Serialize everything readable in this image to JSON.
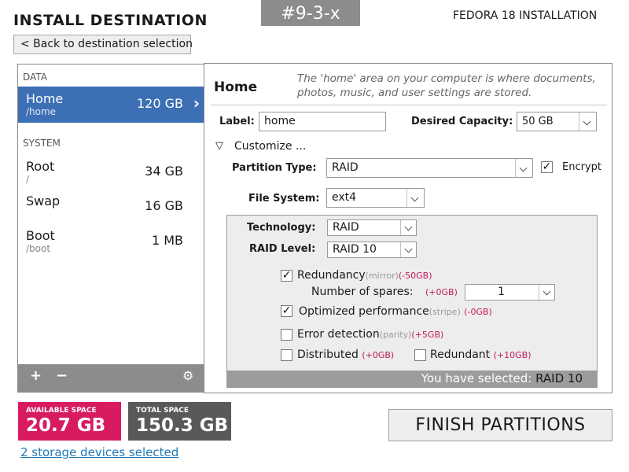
{
  "header": {
    "title": "INSTALL DESTINATION",
    "mockup_tag": "#9-3-x",
    "product": "FEDORA 18 INSTALLATION",
    "back_label": "< Back to destination selection"
  },
  "left_pane": {
    "data_header": "DATA",
    "system_header": "SYSTEM",
    "data_items": [
      {
        "name": "Home",
        "path": "/home",
        "size": "120 GB",
        "selected": true
      }
    ],
    "system_items": [
      {
        "name": "Root",
        "path": "/",
        "size": "34 GB"
      },
      {
        "name": "Swap",
        "path": "",
        "size": "16 GB"
      },
      {
        "name": "Boot",
        "path": "/boot",
        "size": "1 MB"
      }
    ],
    "toolbar": {
      "add": "+",
      "remove": "−",
      "settings": "⚙"
    }
  },
  "details": {
    "title": "Home",
    "description": "The 'home' area on your computer is where documents, photos, music, and user settings are stored.",
    "label_label": "Label:",
    "label_value": "home",
    "capacity_label": "Desired Capacity:",
    "capacity_value": "50 GB",
    "customize_label": "Customize ...",
    "partition_type_label": "Partition Type:",
    "partition_type_value": "RAID",
    "encrypt_label": "Encrypt",
    "encrypt_checked": true,
    "filesystem_label": "File System:",
    "filesystem_value": "ext4"
  },
  "raid": {
    "technology_label": "Technology:",
    "technology_value": "RAID",
    "level_label": "RAID Level:",
    "level_value": "RAID 10",
    "redundancy": {
      "label": "Redundancy",
      "hint": "(mirror)",
      "delta": "(-50GB)",
      "checked": true
    },
    "spares": {
      "label": "Number of spares:",
      "delta": "(+0GB)",
      "value": "1"
    },
    "optimized": {
      "label": "Optimized performance",
      "hint": "(stripe)",
      "delta": "(-0GB)",
      "checked": true
    },
    "error_detection": {
      "label": "Error detection",
      "hint": "(parity)",
      "delta": "(+5GB)",
      "checked": false
    },
    "distributed": {
      "label": "Distributed",
      "delta": "(+0GB)",
      "checked": false
    },
    "redundant": {
      "label": "Redundant",
      "delta": "(+10GB)",
      "checked": false
    },
    "footer_label": "You have selected:",
    "footer_value": "RAID 10"
  },
  "bottom": {
    "available_label": "AVAILABLE SPACE",
    "available_value": "20.7 GB",
    "total_label": "TOTAL SPACE",
    "total_value": "150.3 GB",
    "storage_link": "2 storage devices selected",
    "finish_label": "FINISH PARTITIONS"
  },
  "colors": {
    "selection": "#3d6fb5",
    "available": "#d81b60",
    "total": "#58595b",
    "link": "#1f7ab8",
    "delta": "#c2185b"
  }
}
